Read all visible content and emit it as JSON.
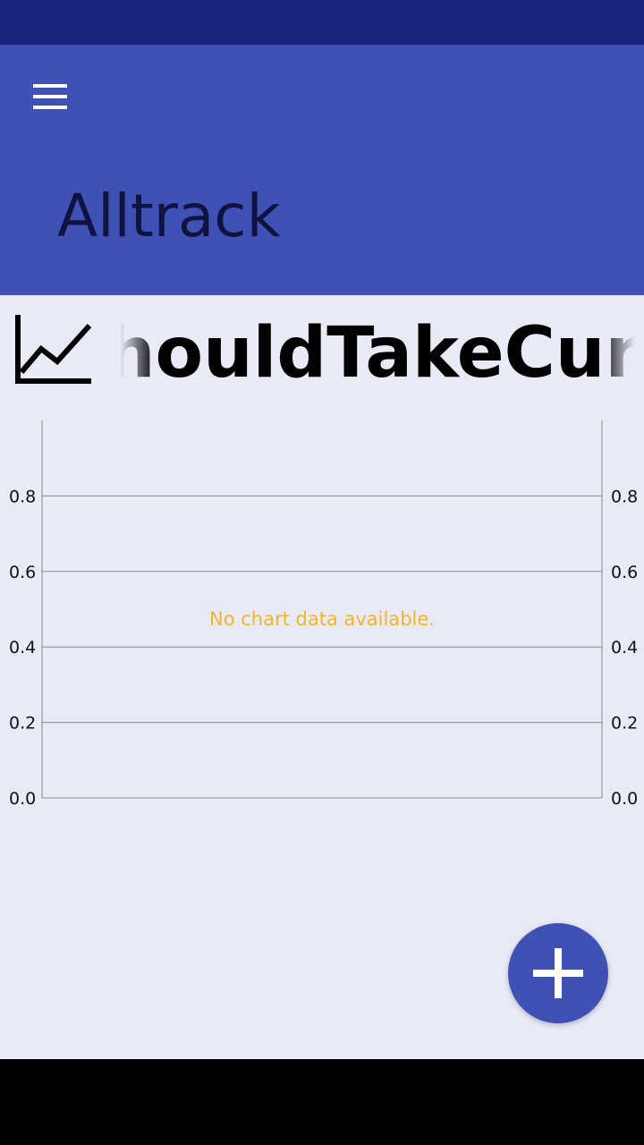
{
  "app_bar": {
    "title": "Alltrack",
    "menu_icon": "menu-icon"
  },
  "tracker": {
    "icon": "trending-up-icon",
    "name": "houldTakeCurre"
  },
  "chart_data": {
    "type": "line",
    "series": [],
    "left_axis": {
      "ticks": [
        "0.0",
        "0.2",
        "0.4",
        "0.6",
        "0.8"
      ],
      "ylim": [
        0,
        1
      ]
    },
    "right_axis": {
      "ticks": [
        "0.0",
        "0.2",
        "0.4",
        "0.6",
        "0.8"
      ],
      "ylim": [
        0,
        1
      ]
    },
    "grid": true,
    "empty_message": "No chart data available."
  },
  "fab": {
    "icon": "plus-icon"
  },
  "colors": {
    "status_bar": "#1a237e",
    "app_bar": "#3f51b5",
    "background": "#e8eaf6",
    "empty_message": "#f2b52b"
  }
}
